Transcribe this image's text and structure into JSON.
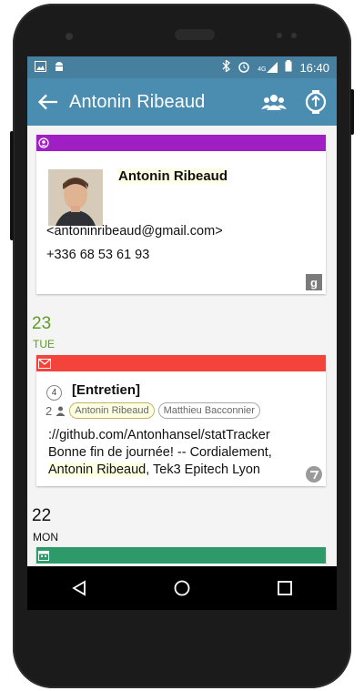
{
  "status_bar": {
    "time": "16:40",
    "network": "4G",
    "icons": [
      "image-icon",
      "android-icon",
      "bluetooth-icon",
      "alarm-icon",
      "signal-icon",
      "battery-icon"
    ]
  },
  "app_bar": {
    "title": "Antonin Ribeaud",
    "icons": [
      "back-arrow-icon",
      "contacts-group-icon",
      "upload-icon"
    ],
    "color": "#4b8cb1"
  },
  "contact_card": {
    "name": "Antonin Ribeaud",
    "email": "<antoninribeaud@gmail.com>",
    "phone": "+336 68 53 61 93",
    "source_badge": "g",
    "band_color": "#a01fc5"
  },
  "date_groups": [
    {
      "day_number": "23",
      "weekday": "TUE",
      "color": "#5d9c22"
    },
    {
      "day_number": "22",
      "weekday": "MON",
      "color": "#111111"
    }
  ],
  "mail_card": {
    "count": "4",
    "subject": "[Entretien]",
    "participant_count": "2",
    "participants": [
      "Antonin Ribeaud",
      "Matthieu Bacconnier"
    ],
    "snippet_line1": "://github.com/Antonhansel/statTracker",
    "snippet_line2": "Bonne fin de journée! -- Cordialement,",
    "snippet_highlight": "Antonin Ribeaud",
    "snippet_tail": ", Tek3 Epitech Lyon",
    "band_color": "#f4433a"
  },
  "calendar_card": {
    "band_color": "#2e9a6a"
  },
  "nav_bar": {
    "buttons": [
      "back-triangle-icon",
      "home-circle-icon",
      "recents-square-icon"
    ]
  }
}
